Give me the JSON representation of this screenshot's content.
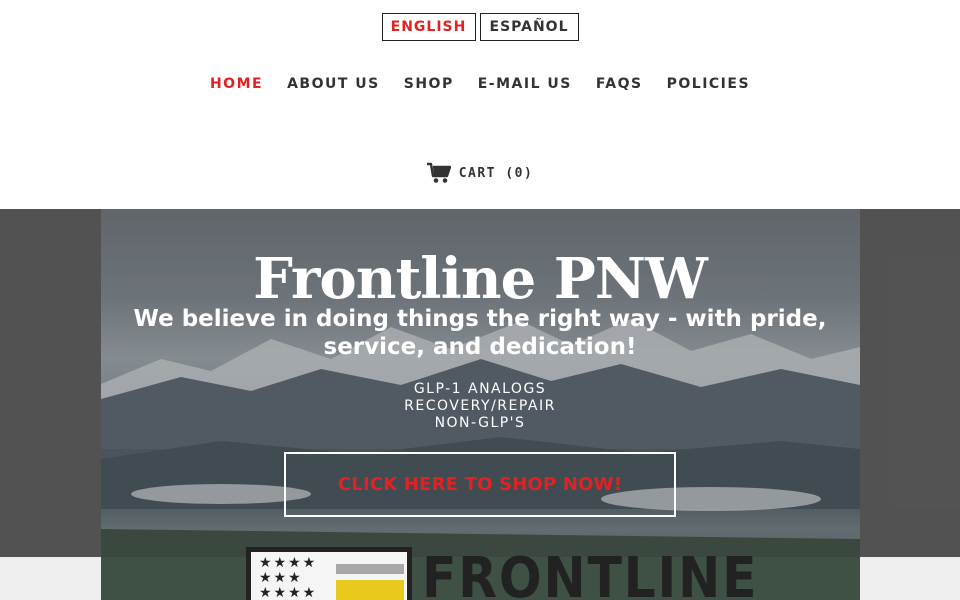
{
  "languages": [
    {
      "label": "ENGLISH",
      "active": true
    },
    {
      "label": "ESPAÑOL",
      "active": false
    }
  ],
  "nav": {
    "items": [
      {
        "label": "HOME",
        "active": true
      },
      {
        "label": "ABOUT US",
        "active": false
      },
      {
        "label": "SHOP",
        "active": false
      },
      {
        "label": "E-MAIL US",
        "active": false
      },
      {
        "label": "FAQS",
        "active": false
      },
      {
        "label": "POLICIES",
        "active": false
      }
    ]
  },
  "cart": {
    "icon": "shopping-cart-icon",
    "label": "CART (0)"
  },
  "hero": {
    "title": "Frontline PNW",
    "subtitle": "We believe in doing things the right way - with pride, service, and dedication!",
    "list": [
      "GLP-1 ANALOGS",
      "RECOVERY/REPAIR",
      "NON-GLP'S"
    ],
    "cta_label": "CLICK HERE TO SHOP NOW!"
  },
  "logo": {
    "text": "FRONTLINE"
  },
  "colors": {
    "accent": "#e02222",
    "text": "#333333",
    "hero_band": "#5c5c5c"
  }
}
